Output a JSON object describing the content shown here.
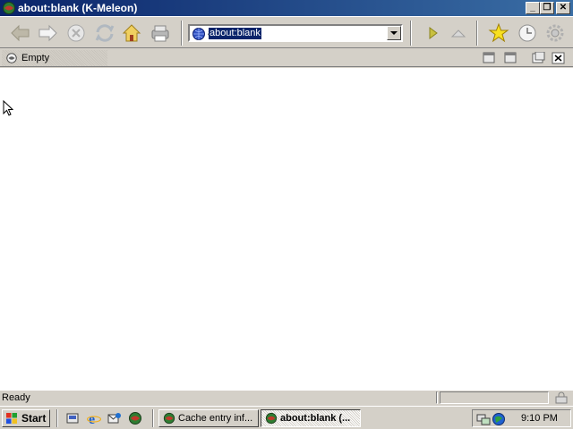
{
  "window": {
    "title": "about:blank (K-Meleon)"
  },
  "window_controls": {
    "minimize": "_",
    "maximize": "❐",
    "close": "✕"
  },
  "address_bar": {
    "value": "about:blank"
  },
  "tab": {
    "label": "Empty"
  },
  "status": {
    "text": "Ready"
  },
  "taskbar": {
    "start_label": "Start",
    "tasks": [
      {
        "label": "Cache entry inf..."
      },
      {
        "label": "about:blank (..."
      }
    ],
    "clock": "9:10 PM"
  },
  "colors": {
    "titlebar": "#0a246a",
    "face": "#d4d0c8",
    "selection": "#0a246a"
  }
}
